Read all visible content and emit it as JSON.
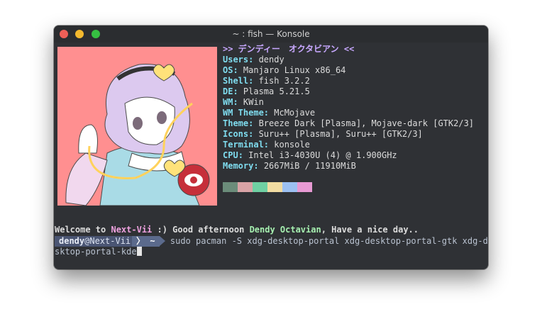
{
  "window": {
    "title": "~ : fish — Konsole"
  },
  "info": {
    "header": ">> デンディー　オクタビアン <<",
    "rows": [
      {
        "key": "Users",
        "value": " dendy"
      },
      {
        "key": "OS",
        "value": " Manjaro Linux x86_64"
      },
      {
        "key": "Shell",
        "value": " fish 3.2.2"
      },
      {
        "key": "DE",
        "value": " Plasma 5.21.5"
      },
      {
        "key": "WM",
        "value": " KWin"
      },
      {
        "key": "WM Theme",
        "value": " McMojave"
      },
      {
        "key": "Theme",
        "value": " Breeze Dark [Plasma], Mojave-dark [GTK2/3]"
      },
      {
        "key": "Icons",
        "value": " Suru++ [Plasma], Suru++ [GTK2/3]"
      },
      {
        "key": "Terminal",
        "value": " konsole"
      },
      {
        "key": "CPU",
        "value": " Intel i3-4030U (4) @ 1.900GHz"
      },
      {
        "key": "Memory",
        "value": " 2667MiB / 11910MiB"
      }
    ],
    "colon": ":",
    "swatches": [
      "#6b8c7a",
      "#d9a3a6",
      "#6fd0a3",
      "#f2dca2",
      "#9cc0f2",
      "#e89ad4"
    ]
  },
  "welcome": {
    "p1": "Welcome to ",
    "host": "Next-Vii",
    "p2": " :) Good afternoon ",
    "name": "Dendy Octavian",
    "p3": ", Have a nice day.."
  },
  "prompt": {
    "user": "dendy",
    "at_host": "@Next-Vii",
    "sep": "〉",
    "dir": "~",
    "command": "sudo pacman -S xdg-desktop-portal xdg-desktop-portal-gtk xdg-de",
    "continuation": "sktop-portal-kde"
  },
  "colors": {
    "accent_key": "#7fdcef",
    "header": "#c8a8ff",
    "art_background": "#ff8f90"
  }
}
